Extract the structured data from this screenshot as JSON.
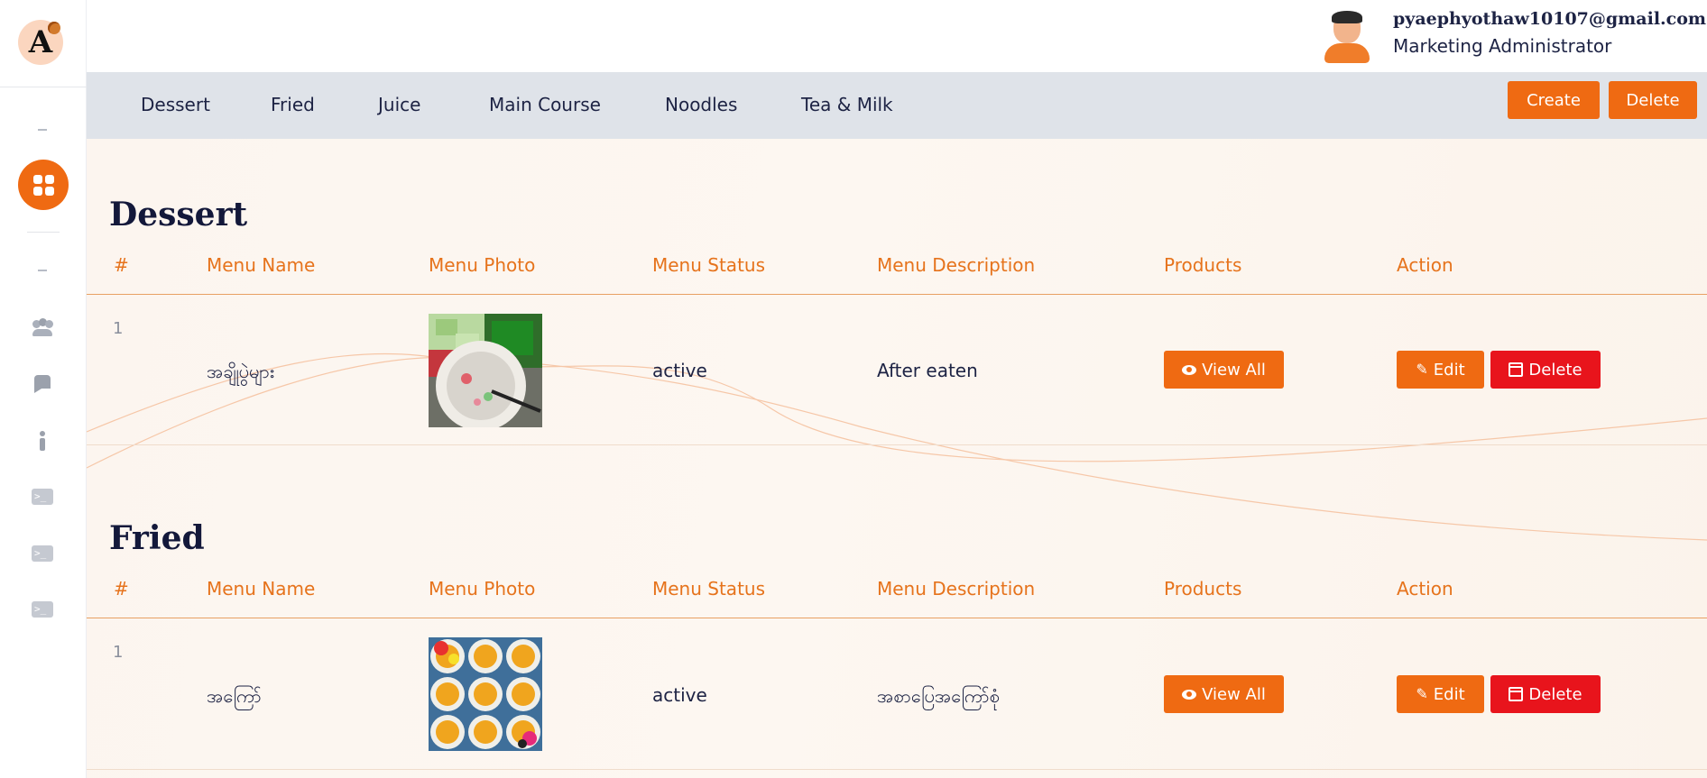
{
  "sidebar": {
    "logo_letter": "A",
    "icons": [
      "dash-icon",
      "dashboard-grid-icon",
      "dash-icon",
      "users-icon",
      "chat-icon",
      "info-icon",
      "terminal-icon",
      "terminal-icon",
      "terminal-icon"
    ]
  },
  "header": {
    "user_email": "pyaephyothaw10107@gmail.com",
    "user_role": "Marketing Administrator"
  },
  "tabs": [
    "Dessert",
    "Fried",
    "Juice",
    "Main Course",
    "Noodles",
    "Tea & Milk"
  ],
  "toolbar": {
    "create_label": "Create",
    "delete_label": "Delete"
  },
  "table_headers": [
    "#",
    "Menu Name",
    "Menu Photo",
    "Menu Status",
    "Menu Description",
    "Products",
    "Action"
  ],
  "sections": [
    {
      "title": "Dessert",
      "rows": [
        {
          "num": "1",
          "name": "အချိုပွဲများ",
          "status": "active",
          "description": "After eaten",
          "view_label": "View All",
          "edit_label": "Edit",
          "delete_label": "Delete"
        }
      ]
    },
    {
      "title": "Fried",
      "rows": [
        {
          "num": "1",
          "name": "အကြော်",
          "status": "active",
          "description": "အစာပြေအကြော်စုံ",
          "view_label": "View All",
          "edit_label": "Edit",
          "delete_label": "Delete"
        }
      ]
    }
  ],
  "colors": {
    "accent": "#ef6a12",
    "danger": "#e8141c",
    "header_text": "#e6731c",
    "tabbar_bg": "#dfe3e9"
  }
}
